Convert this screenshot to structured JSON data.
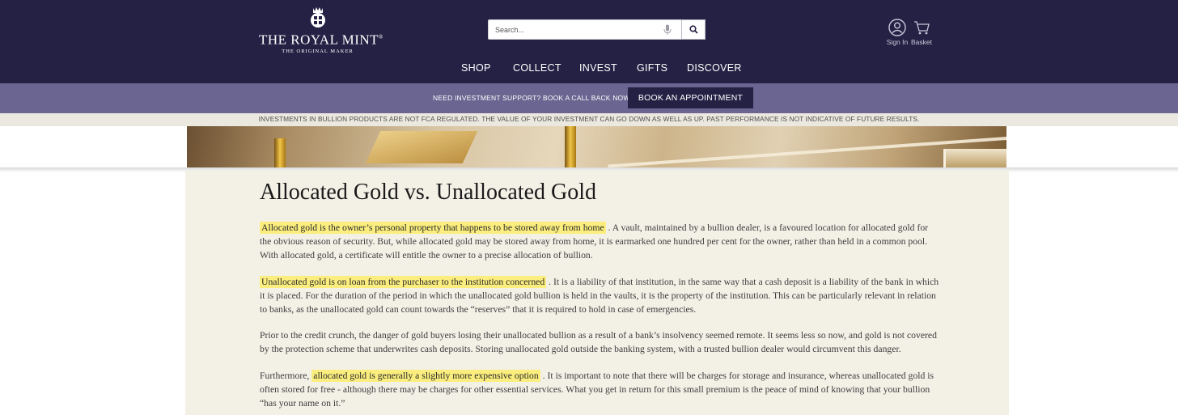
{
  "header": {
    "logo": {
      "name": "THE ROYAL MINT",
      "registered": "®",
      "tagline": "THE ORIGINAL MAKER"
    },
    "search": {
      "placeholder": "Search..."
    },
    "account": {
      "sign_in": "Sign In",
      "basket": "Basket"
    },
    "nav": [
      "SHOP",
      "COLLECT",
      "INVEST",
      "GIFTS",
      "DISCOVER"
    ]
  },
  "support_bar": {
    "text": "NEED INVESTMENT SUPPORT? BOOK A CALL BACK NOW",
    "button": "BOOK AN APPOINTMENT"
  },
  "disclaimer": "INVESTMENTS IN BULLION PRODUCTS ARE NOT FCA REGULATED. THE VALUE OF YOUR INVESTMENT CAN GO DOWN AS WELL AS UP. PAST PERFORMANCE IS NOT INDICATIVE OF FUTURE RESULTS.",
  "article": {
    "title": "Allocated Gold vs. Unallocated Gold",
    "paragraphs": [
      {
        "highlight": "Allocated gold is the owner’s personal property that happens to be stored away from home",
        "text": " . A vault, maintained by a bullion dealer, is a favoured location for allocated gold for the obvious reason of security. But, while allocated gold may be stored away from home, it is earmarked one hundred per cent for the owner, rather than held in a common pool. With allocated gold, a certificate will entitle the owner to a precise allocation of bullion."
      },
      {
        "highlight": "Unallocated gold is on loan from the purchaser to the institution concerned",
        "text": " . It is a liability of that institution, in the same way that a cash deposit is a liability of the bank in which it is placed. For the duration of the period in which the unallocated gold bullion is held in the vaults, it is the property of the institution. This can be particularly relevant in relation to banks, as the unallocated gold can count towards the “reserves” that it is required to hold in case of emergencies."
      },
      {
        "text": "Prior to the credit crunch, the danger of gold buyers losing their unallocated bullion as a result of a bank’s insolvency seemed remote. It seems less so now, and gold is not covered by the protection scheme that underwrites cash deposits. Storing unallocated gold outside the banking system, with a trusted bullion dealer would circumvent this danger."
      },
      {
        "before": "Furthermore, ",
        "highlight": "allocated gold is generally a slightly more expensive option",
        "text": " . It is important to note that there will be charges for storage and insurance, whereas unallocated gold is often stored for free - although there may be charges for other essential services. What you get in return for this small premium is the peace of mind of knowing that your bullion “has your name on it.”"
      }
    ]
  },
  "colors": {
    "header_bg": "#252145",
    "support_bar_bg": "#6b6591",
    "disclaimer_bg": "#ebe8df",
    "article_bg": "#f3f0e6",
    "highlight": "#fbee7e"
  },
  "icons": [
    "crest-icon",
    "microphone-icon",
    "search-icon",
    "user-icon",
    "basket-icon"
  ]
}
